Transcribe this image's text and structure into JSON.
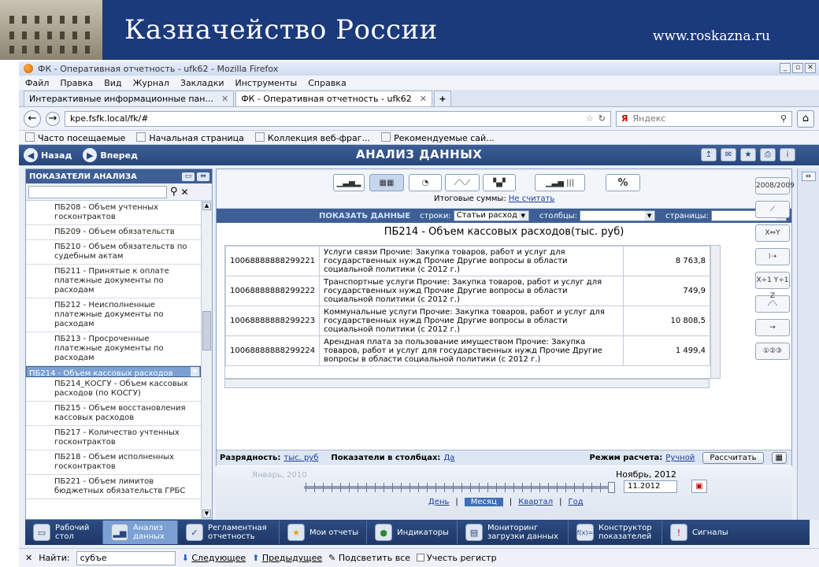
{
  "banner": {
    "title": "Казначейство России",
    "url": "www.roskazna.ru"
  },
  "browser": {
    "window_title": "ФК - Оперативная отчетность - ufk62 - Mozilla Firefox",
    "window_buttons": [
      "_",
      "▫",
      "✕"
    ],
    "menu": [
      "Файл",
      "Правка",
      "Вид",
      "Журнал",
      "Закладки",
      "Инструменты",
      "Справка"
    ],
    "tabs": [
      {
        "label": "Интерактивные информационные пан...",
        "close": "✕"
      },
      {
        "label": "ФК - Оперативная отчетность - ufk62",
        "close": "✕"
      }
    ],
    "new_tab": "+",
    "address": "kpe.fsfk.local/fk/#",
    "search_engine": "Яндекс",
    "bookmarks": [
      "Часто посещаемые",
      "Начальная страница",
      "Коллекция веб-фраг...",
      "Рекомендуемые сай..."
    ]
  },
  "app": {
    "back": "Назад",
    "forward": "Вперед",
    "title": "АНАЛИЗ ДАННЫХ",
    "sidebar_title": "ПОКАЗАТЕЛИ АНАЛИЗА",
    "indicators": [
      {
        "label": "ПБ208 - Объем учтенных госконтрактов",
        "selected": false
      },
      {
        "label": "ПБ209 - Объем обязательств",
        "selected": false
      },
      {
        "label": "ПБ210 - Объем обязательств по судебным актам",
        "selected": false
      },
      {
        "label": "ПБ211 - Принятые к оплате платежные документы по расходам",
        "selected": false
      },
      {
        "label": "ПБ212 - Неисполненные платежные документы по расходам",
        "selected": false
      },
      {
        "label": "ПБ213 - Просроченные платежные документы по расходам",
        "selected": false
      },
      {
        "label": "ПБ214 - Объем кассовых расходов",
        "selected": true
      },
      {
        "label": "ПБ214_КОСГУ - Объем кассовых расходов (по КОСГУ)",
        "selected": false
      },
      {
        "label": "ПБ215 - Объем восстановления кассовых расходов",
        "selected": false
      },
      {
        "label": "ПБ217 - Количество учтенных госконтрактов",
        "selected": false
      },
      {
        "label": "ПБ218 - Объем исполненных госконтрактов",
        "selected": false
      },
      {
        "label": "ПБ221 - Объем лимитов бюджетных обязательств ГРБС",
        "selected": false
      }
    ],
    "totals_label": "Итоговые суммы:",
    "totals_value": "Не считать",
    "show_data": "ПОКАЗАТЬ ДАННЫЕ",
    "rows_label": "строки:",
    "rows_value": "Статьи расход",
    "cols_label": "столбцы:",
    "cols_value": "",
    "pages_label": "страницы:",
    "pages_value": "",
    "percent": "%",
    "report_title": "ПБ214 - Объем кассовых расходов(тыс. руб)",
    "table": [
      {
        "code": "10068888888299221",
        "desc": "Услуги связи Прочие: Закупка товаров, работ и услуг для государственных нужд Прочие Другие вопросы в области социальной политики (с 2012 г.)",
        "value": "8 763,8"
      },
      {
        "code": "10068888888299222",
        "desc": "Транспортные услуги Прочие: Закупка товаров, работ и услуг для государственных нужд Прочие Другие вопросы в области социальной политики (с 2012 г.)",
        "value": "749,9"
      },
      {
        "code": "10068888888299223",
        "desc": "Коммунальные услуги Прочие: Закупка товаров, работ и услуг для государственных нужд Прочие Другие вопросы в области социальной политики (с 2012 г.)",
        "value": "10 808,5"
      },
      {
        "code": "10068888888299224",
        "desc": "Арендная плата за пользование имуществом Прочие: Закупка товаров, работ и услуг для государственных нужд Прочие Другие вопросы в области социальной политики (с 2012 г.)",
        "value": "1 499,4"
      }
    ],
    "right_tools": [
      "2008/2009",
      "⟋",
      "X⇔Y",
      "⁞⇢",
      "X÷1 Y÷1 Z",
      "⟋⟍",
      "→",
      "①②③"
    ],
    "scale_label": "Разрядность:",
    "scale_value": "тыс. руб",
    "incols_label": "Показатели в столбцах:",
    "incols_value": "Да",
    "calc_mode_label": "Режим расчета:",
    "calc_mode_value": "Ручной",
    "calc_button": "Рассчитать",
    "timeline_start": "Январь, 2010",
    "timeline_end": "Ноябрь, 2012",
    "date_value": "11.2012",
    "period_tabs": [
      {
        "label": "День",
        "active": false
      },
      {
        "label": "Месяц",
        "active": true
      },
      {
        "label": "Квартал",
        "active": false
      },
      {
        "label": "Год",
        "active": false
      }
    ]
  },
  "modules": [
    {
      "label": "Рабочий стол",
      "icon": "desktop-icon",
      "active": false
    },
    {
      "label": "Анализ данных",
      "icon": "chart-icon",
      "active": true
    },
    {
      "label": "Регламентная отчетность",
      "icon": "checklist-icon",
      "active": false
    },
    {
      "label": "Мои отчеты",
      "icon": "star-icon",
      "active": false
    },
    {
      "label": "Индикаторы",
      "icon": "indicator-icon",
      "active": false
    },
    {
      "label": "Мониторинг загрузки данных",
      "icon": "monitor-icon",
      "active": false
    },
    {
      "label": "Конструктор показателей",
      "icon": "formula-icon",
      "active": false
    },
    {
      "label": "Сигналы",
      "icon": "signal-icon",
      "active": false
    }
  ],
  "findbar": {
    "close": "✕",
    "label": "Найти:",
    "value": "субъе",
    "next": "Следующее",
    "prev": "Предыдущее",
    "highlight": "Подсветить все",
    "match_case": "Учесть регистр"
  }
}
